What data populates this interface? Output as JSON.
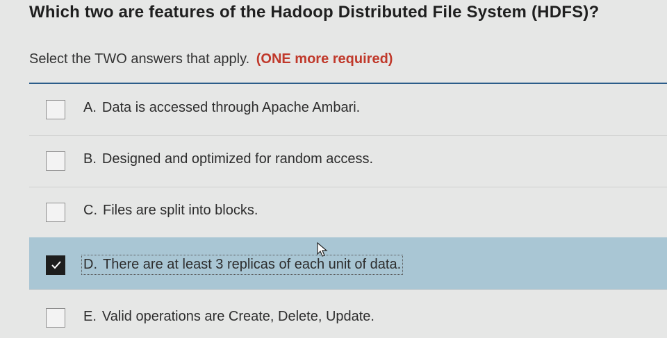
{
  "question": {
    "title": "Which two are features of the Hadoop Distributed File System (HDFS)?",
    "instructions": "Select the TWO answers that apply.",
    "required_note": "(ONE more required)"
  },
  "options": [
    {
      "letter": "A.",
      "text": "Data is accessed through Apache Ambari.",
      "checked": false
    },
    {
      "letter": "B.",
      "text": "Designed and optimized for random access.",
      "checked": false
    },
    {
      "letter": "C.",
      "text": "Files are split into blocks.",
      "checked": false
    },
    {
      "letter": "D.",
      "text": "There are at least 3 replicas of each unit of data.",
      "checked": true
    },
    {
      "letter": "E.",
      "text": "Valid operations are Create, Delete, Update.",
      "checked": false
    }
  ],
  "colors": {
    "selected_row": "#a9c6d4",
    "required": "#c0392b",
    "divider": "#2c5d8a"
  },
  "icons": {
    "checkmark": "check-icon",
    "cursor": "mouse-pointer-icon"
  }
}
